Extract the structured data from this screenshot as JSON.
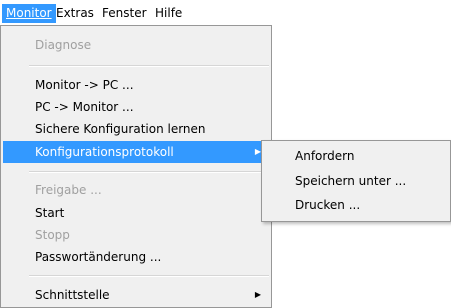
{
  "menubar": {
    "items": [
      {
        "label": "Monitor",
        "active": true
      },
      {
        "label": "Extras"
      },
      {
        "label": "Fenster"
      },
      {
        "label": "Hilfe"
      }
    ]
  },
  "dropdown": {
    "diagnose": "Diagnose",
    "monitor_to_pc": "Monitor -> PC ...",
    "pc_to_monitor": "PC -> Monitor ...",
    "learn_config": "Sichere Konfiguration lernen",
    "config_protocol": "Konfigurationsprotokoll",
    "freigabe": "Freigabe ...",
    "start": "Start",
    "stopp": "Stopp",
    "password_change": "Passwortänderung ...",
    "schnittstelle": "Schnittstelle"
  },
  "submenu": {
    "anfordern": "Anfordern",
    "speichern": "Speichern unter ...",
    "drucken": "Drucken ..."
  },
  "colors": {
    "highlight": "#3399ff",
    "menu_bg": "#f0f0f0",
    "disabled_text": "#a0a0a0"
  }
}
